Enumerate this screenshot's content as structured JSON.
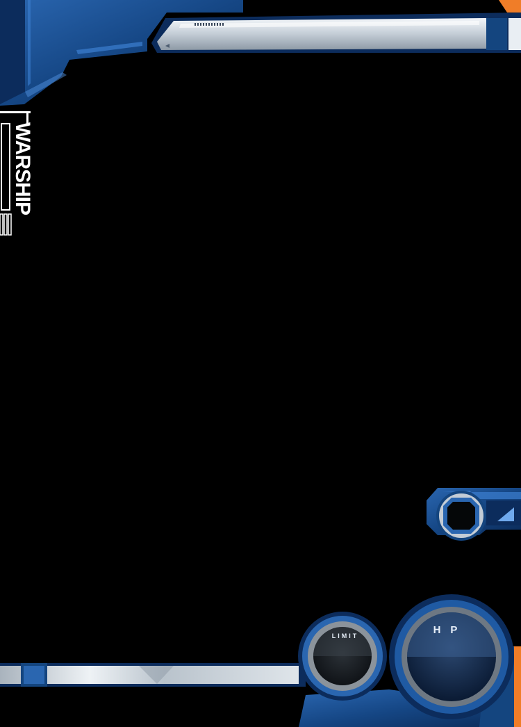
{
  "side_panel": {
    "title": "WARSHIP"
  },
  "gauges": {
    "limit_label": "LIMIT",
    "hp_label": "HP"
  },
  "icons": {
    "top_bar_marker": "left-triangle-icon",
    "command_indicator": "triangle-right-icon"
  },
  "colors": {
    "background": "#000000",
    "frame_blue": "#1a4f8f",
    "frame_highlight": "#3c7fd0",
    "frame_dark": "#0c2c5c",
    "silver": "#d5dde4",
    "accent_orange": "#f07d28"
  }
}
